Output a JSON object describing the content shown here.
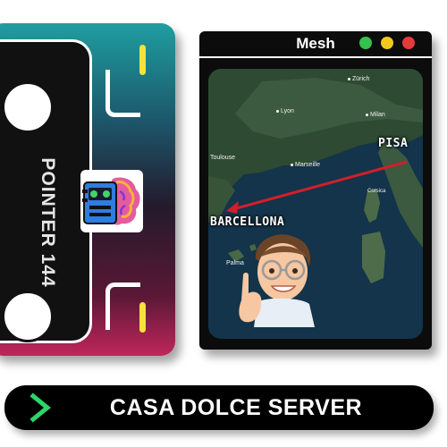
{
  "cassette": {
    "label": "POINTER 144",
    "logo_icon": "cassette-brain-icon"
  },
  "window": {
    "title": "Mesh",
    "buttons": [
      "green",
      "yellow",
      "red"
    ],
    "colors": {
      "green": "#35c14d",
      "yellow": "#f2c81c",
      "red": "#e33b3b"
    }
  },
  "map": {
    "cities": [
      "Zürich",
      "Lyon",
      "Milan",
      "Toulouse",
      "Marseille",
      "Corsica",
      "Palma"
    ],
    "route": {
      "from": "PISA",
      "to": "BARCELLONA",
      "color": "#d11f2a"
    },
    "avatar_icon": "memoji-pointing-icon"
  },
  "bottom_bar": {
    "prompt_icon": "chevron-right-icon",
    "prompt_color": "#2fd36a",
    "label": "CASA DOLCE SERVER"
  }
}
